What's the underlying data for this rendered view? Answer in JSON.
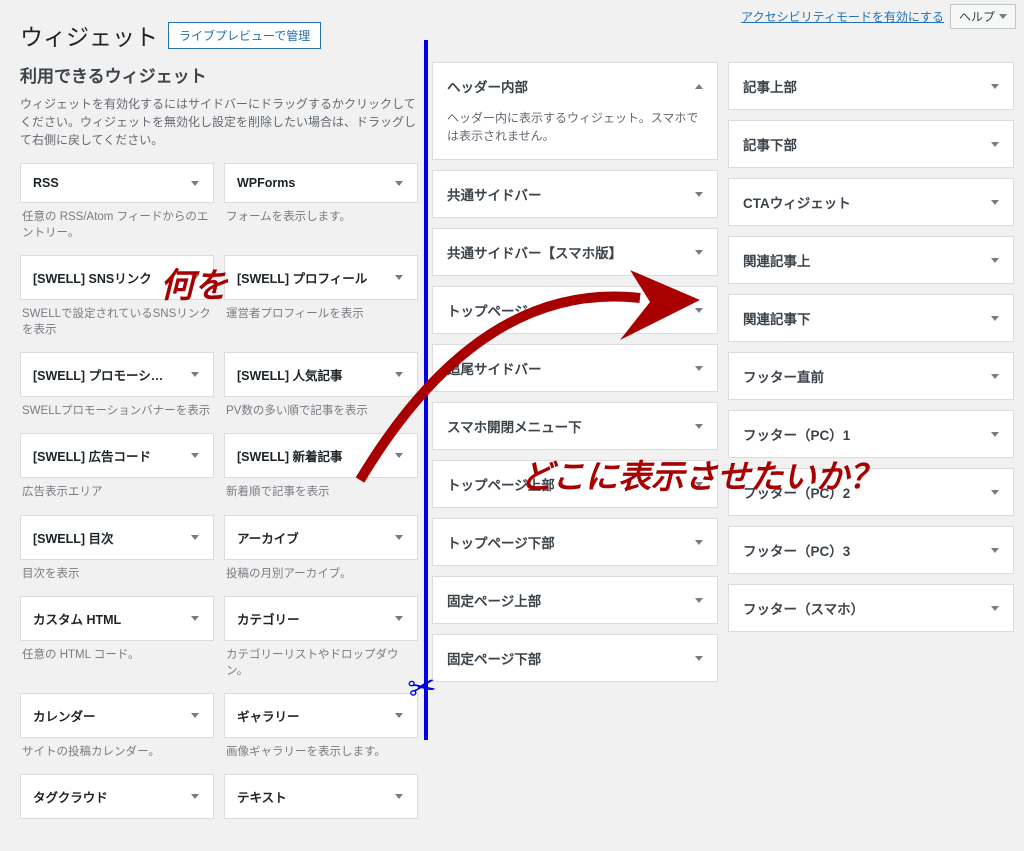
{
  "topbar": {
    "accessibility_link": "アクセシビリティモードを有効にする",
    "help_label": "ヘルプ"
  },
  "header": {
    "title": "ウィジェット",
    "preview_button": "ライブプレビューで管理"
  },
  "available": {
    "heading": "利用できるウィジェット",
    "intro": "ウィジェットを有効化するにはサイドバーにドラッグするかクリックしてください。ウィジェットを無効化し設定を削除したい場合は、ドラッグして右側に戻してください。",
    "widgets": [
      {
        "title": "RSS",
        "desc": "任意の RSS/Atom フィードからのエントリー。"
      },
      {
        "title": "WPForms",
        "desc": "フォームを表示します。"
      },
      {
        "title": "[SWELL] SNSリンク",
        "desc": "SWELLで設定されているSNSリンクを表示"
      },
      {
        "title": "[SWELL] プロフィール",
        "desc": "運営者プロフィールを表示"
      },
      {
        "title": "[SWELL] プロモーシ…",
        "desc": "SWELLプロモーションバナーを表示"
      },
      {
        "title": "[SWELL] 人気記事",
        "desc": "PV数の多い順で記事を表示"
      },
      {
        "title": "[SWELL] 広告コード",
        "desc": "広告表示エリア"
      },
      {
        "title": "[SWELL] 新着記事",
        "desc": "新着順で記事を表示"
      },
      {
        "title": "[SWELL] 目次",
        "desc": "目次を表示"
      },
      {
        "title": "アーカイブ",
        "desc": "投稿の月別アーカイブ。"
      },
      {
        "title": "カスタム HTML",
        "desc": "任意の HTML コード。"
      },
      {
        "title": "カテゴリー",
        "desc": "カテゴリーリストやドロップダウン。"
      },
      {
        "title": "カレンダー",
        "desc": "サイトの投稿カレンダー。"
      },
      {
        "title": "ギャラリー",
        "desc": "画像ギャラリーを表示します。"
      },
      {
        "title": "タグクラウド",
        "desc": ""
      },
      {
        "title": "テキスト",
        "desc": ""
      }
    ]
  },
  "areas_col1": [
    {
      "title": "ヘッダー内部",
      "open": true,
      "desc": "ヘッダー内に表示するウィジェット。スマホでは表示されません。"
    },
    {
      "title": "共通サイドバー"
    },
    {
      "title": "共通サイドバー【スマホ版】"
    },
    {
      "title": "トップページ"
    },
    {
      "title": "追尾サイドバー"
    },
    {
      "title": "スマホ開閉メニュー下"
    },
    {
      "title": "トップページ上部"
    },
    {
      "title": "トップページ下部"
    },
    {
      "title": "固定ページ上部"
    },
    {
      "title": "固定ページ下部"
    }
  ],
  "areas_col2": [
    {
      "title": "記事上部"
    },
    {
      "title": "記事下部"
    },
    {
      "title": "CTAウィジェット"
    },
    {
      "title": "関連記事上"
    },
    {
      "title": "関連記事下"
    },
    {
      "title": "フッター直前"
    },
    {
      "title": "フッター（PC）1"
    },
    {
      "title": "フッター（PC）2"
    },
    {
      "title": "フッター（PC）3"
    },
    {
      "title": "フッター（スマホ）"
    }
  ],
  "annotations": {
    "what": "何を",
    "where": "どこに表示させたいか？"
  }
}
